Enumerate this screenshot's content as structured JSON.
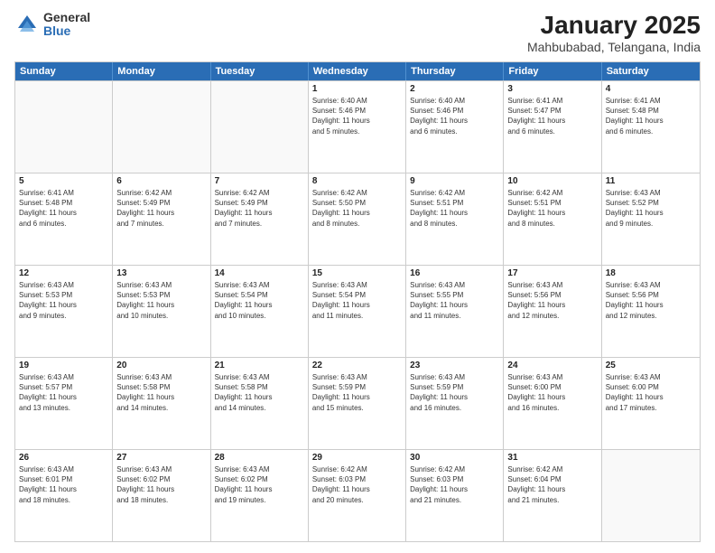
{
  "logo": {
    "general": "General",
    "blue": "Blue"
  },
  "header": {
    "title": "January 2025",
    "subtitle": "Mahbubabad, Telangana, India"
  },
  "days": [
    "Sunday",
    "Monday",
    "Tuesday",
    "Wednesday",
    "Thursday",
    "Friday",
    "Saturday"
  ],
  "weeks": [
    [
      {
        "day": "",
        "lines": []
      },
      {
        "day": "",
        "lines": []
      },
      {
        "day": "",
        "lines": []
      },
      {
        "day": "1",
        "lines": [
          "Sunrise: 6:40 AM",
          "Sunset: 5:46 PM",
          "Daylight: 11 hours",
          "and 5 minutes."
        ]
      },
      {
        "day": "2",
        "lines": [
          "Sunrise: 6:40 AM",
          "Sunset: 5:46 PM",
          "Daylight: 11 hours",
          "and 6 minutes."
        ]
      },
      {
        "day": "3",
        "lines": [
          "Sunrise: 6:41 AM",
          "Sunset: 5:47 PM",
          "Daylight: 11 hours",
          "and 6 minutes."
        ]
      },
      {
        "day": "4",
        "lines": [
          "Sunrise: 6:41 AM",
          "Sunset: 5:48 PM",
          "Daylight: 11 hours",
          "and 6 minutes."
        ]
      }
    ],
    [
      {
        "day": "5",
        "lines": [
          "Sunrise: 6:41 AM",
          "Sunset: 5:48 PM",
          "Daylight: 11 hours",
          "and 6 minutes."
        ]
      },
      {
        "day": "6",
        "lines": [
          "Sunrise: 6:42 AM",
          "Sunset: 5:49 PM",
          "Daylight: 11 hours",
          "and 7 minutes."
        ]
      },
      {
        "day": "7",
        "lines": [
          "Sunrise: 6:42 AM",
          "Sunset: 5:49 PM",
          "Daylight: 11 hours",
          "and 7 minutes."
        ]
      },
      {
        "day": "8",
        "lines": [
          "Sunrise: 6:42 AM",
          "Sunset: 5:50 PM",
          "Daylight: 11 hours",
          "and 8 minutes."
        ]
      },
      {
        "day": "9",
        "lines": [
          "Sunrise: 6:42 AM",
          "Sunset: 5:51 PM",
          "Daylight: 11 hours",
          "and 8 minutes."
        ]
      },
      {
        "day": "10",
        "lines": [
          "Sunrise: 6:42 AM",
          "Sunset: 5:51 PM",
          "Daylight: 11 hours",
          "and 8 minutes."
        ]
      },
      {
        "day": "11",
        "lines": [
          "Sunrise: 6:43 AM",
          "Sunset: 5:52 PM",
          "Daylight: 11 hours",
          "and 9 minutes."
        ]
      }
    ],
    [
      {
        "day": "12",
        "lines": [
          "Sunrise: 6:43 AM",
          "Sunset: 5:53 PM",
          "Daylight: 11 hours",
          "and 9 minutes."
        ]
      },
      {
        "day": "13",
        "lines": [
          "Sunrise: 6:43 AM",
          "Sunset: 5:53 PM",
          "Daylight: 11 hours",
          "and 10 minutes."
        ]
      },
      {
        "day": "14",
        "lines": [
          "Sunrise: 6:43 AM",
          "Sunset: 5:54 PM",
          "Daylight: 11 hours",
          "and 10 minutes."
        ]
      },
      {
        "day": "15",
        "lines": [
          "Sunrise: 6:43 AM",
          "Sunset: 5:54 PM",
          "Daylight: 11 hours",
          "and 11 minutes."
        ]
      },
      {
        "day": "16",
        "lines": [
          "Sunrise: 6:43 AM",
          "Sunset: 5:55 PM",
          "Daylight: 11 hours",
          "and 11 minutes."
        ]
      },
      {
        "day": "17",
        "lines": [
          "Sunrise: 6:43 AM",
          "Sunset: 5:56 PM",
          "Daylight: 11 hours",
          "and 12 minutes."
        ]
      },
      {
        "day": "18",
        "lines": [
          "Sunrise: 6:43 AM",
          "Sunset: 5:56 PM",
          "Daylight: 11 hours",
          "and 12 minutes."
        ]
      }
    ],
    [
      {
        "day": "19",
        "lines": [
          "Sunrise: 6:43 AM",
          "Sunset: 5:57 PM",
          "Daylight: 11 hours",
          "and 13 minutes."
        ]
      },
      {
        "day": "20",
        "lines": [
          "Sunrise: 6:43 AM",
          "Sunset: 5:58 PM",
          "Daylight: 11 hours",
          "and 14 minutes."
        ]
      },
      {
        "day": "21",
        "lines": [
          "Sunrise: 6:43 AM",
          "Sunset: 5:58 PM",
          "Daylight: 11 hours",
          "and 14 minutes."
        ]
      },
      {
        "day": "22",
        "lines": [
          "Sunrise: 6:43 AM",
          "Sunset: 5:59 PM",
          "Daylight: 11 hours",
          "and 15 minutes."
        ]
      },
      {
        "day": "23",
        "lines": [
          "Sunrise: 6:43 AM",
          "Sunset: 5:59 PM",
          "Daylight: 11 hours",
          "and 16 minutes."
        ]
      },
      {
        "day": "24",
        "lines": [
          "Sunrise: 6:43 AM",
          "Sunset: 6:00 PM",
          "Daylight: 11 hours",
          "and 16 minutes."
        ]
      },
      {
        "day": "25",
        "lines": [
          "Sunrise: 6:43 AM",
          "Sunset: 6:00 PM",
          "Daylight: 11 hours",
          "and 17 minutes."
        ]
      }
    ],
    [
      {
        "day": "26",
        "lines": [
          "Sunrise: 6:43 AM",
          "Sunset: 6:01 PM",
          "Daylight: 11 hours",
          "and 18 minutes."
        ]
      },
      {
        "day": "27",
        "lines": [
          "Sunrise: 6:43 AM",
          "Sunset: 6:02 PM",
          "Daylight: 11 hours",
          "and 18 minutes."
        ]
      },
      {
        "day": "28",
        "lines": [
          "Sunrise: 6:43 AM",
          "Sunset: 6:02 PM",
          "Daylight: 11 hours",
          "and 19 minutes."
        ]
      },
      {
        "day": "29",
        "lines": [
          "Sunrise: 6:42 AM",
          "Sunset: 6:03 PM",
          "Daylight: 11 hours",
          "and 20 minutes."
        ]
      },
      {
        "day": "30",
        "lines": [
          "Sunrise: 6:42 AM",
          "Sunset: 6:03 PM",
          "Daylight: 11 hours",
          "and 21 minutes."
        ]
      },
      {
        "day": "31",
        "lines": [
          "Sunrise: 6:42 AM",
          "Sunset: 6:04 PM",
          "Daylight: 11 hours",
          "and 21 minutes."
        ]
      },
      {
        "day": "",
        "lines": []
      }
    ]
  ]
}
